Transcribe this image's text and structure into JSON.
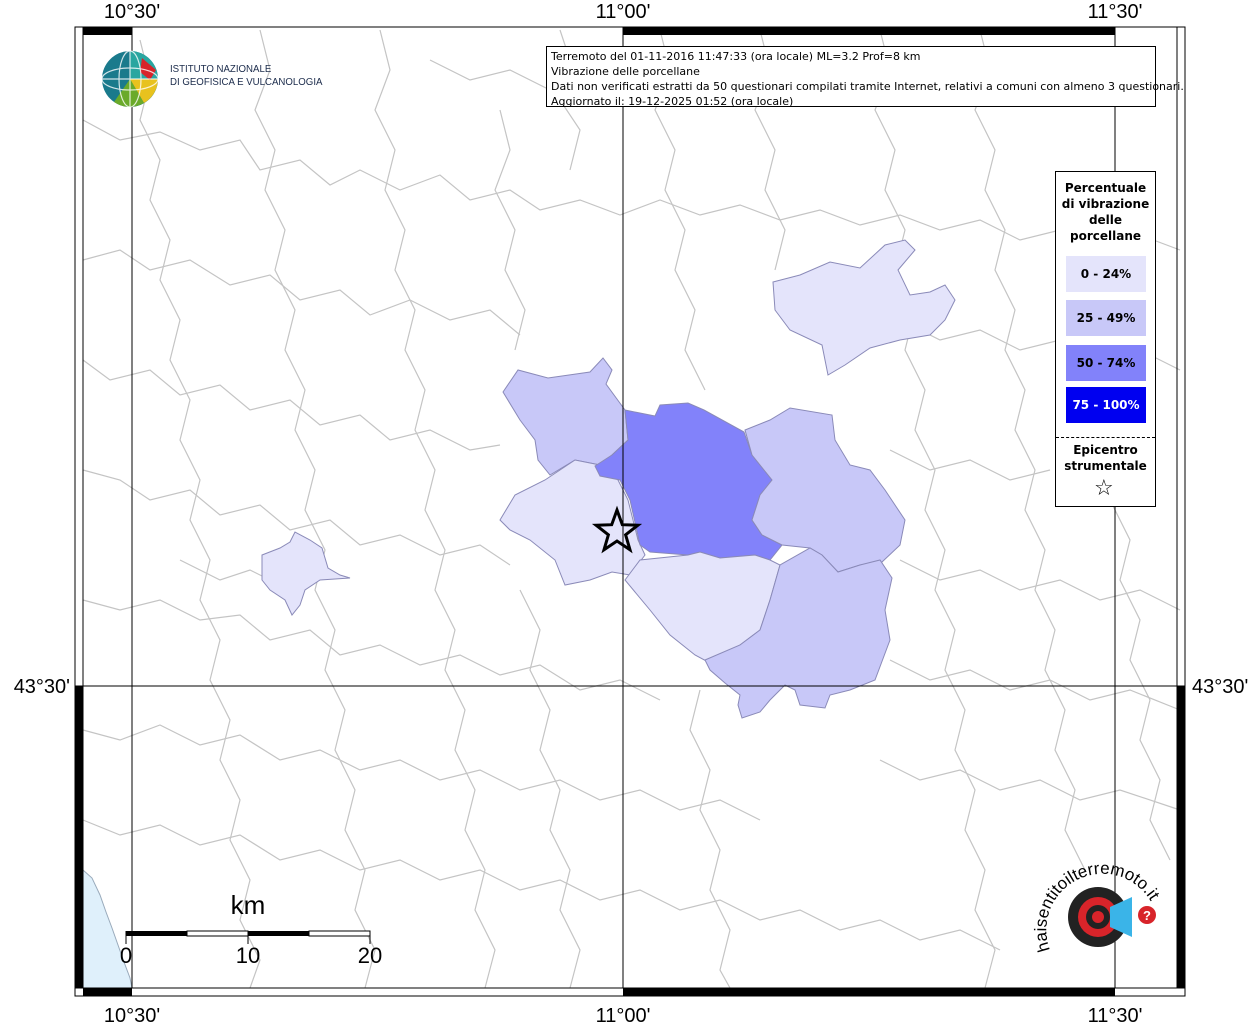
{
  "header": {
    "event_line": "Terremoto del 01-11-2016 11:47:33 (ora locale) ML=3.2 Prof=8 km",
    "map_type": "Vibrazione delle porcellane",
    "data_note": "Dati non verificati estratti da 50 questionari compilati tramite Internet, relativi a comuni con almeno 3 questionari.",
    "updated": "Aggiornato il: 19-12-2025 01:52 (ora locale)"
  },
  "logo": {
    "line1": "ISTITUTO NAZIONALE",
    "line2": "DI GEOFISICA E VULCANOLOGIA"
  },
  "axes": {
    "lon_ticks": [
      "10°30'",
      "11°00'",
      "11°30'"
    ],
    "lat_ticks": [
      "43°30'"
    ]
  },
  "legend": {
    "title_lines": [
      "Percentuale",
      "di vibrazione",
      "delle",
      "porcellane"
    ],
    "classes": [
      {
        "label": "0 - 24%",
        "color": "#e4e4fb",
        "text_color": "#000000"
      },
      {
        "label": "25 - 49%",
        "color": "#c8c8f8",
        "text_color": "#000000"
      },
      {
        "label": "50 - 74%",
        "color": "#8282fa",
        "text_color": "#000000"
      },
      {
        "label": "75 - 100%",
        "color": "#0000f0",
        "text_color": "#ffffff"
      }
    ],
    "epicenter_lines": [
      "Epicentro",
      "strumentale"
    ]
  },
  "scale_bar": {
    "unit": "km",
    "labels": [
      "0",
      "10",
      "20"
    ]
  },
  "watermark": {
    "text": "haisentitoilterremoto.it"
  },
  "colors": {
    "boundary": "#c4c4c4",
    "grid": "#000000",
    "sea": "#dff0fb"
  }
}
